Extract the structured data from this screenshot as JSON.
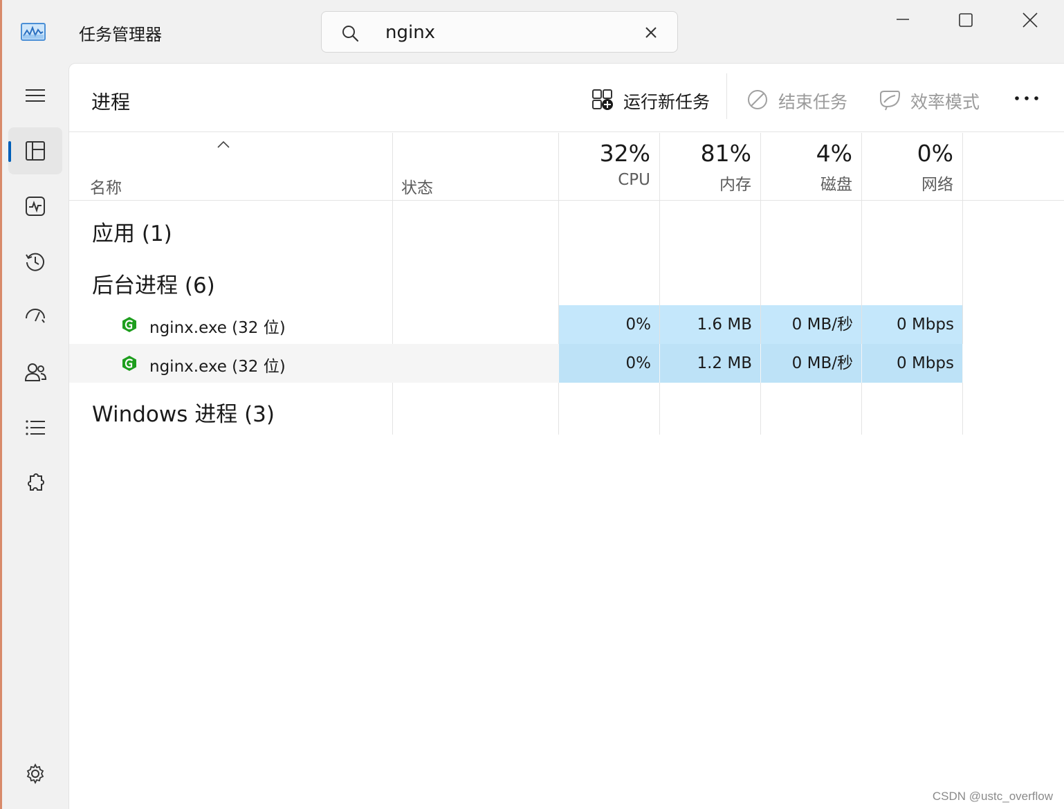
{
  "app": {
    "title": "任务管理器",
    "icon": "task-manager-app-icon"
  },
  "search": {
    "value": "nginx",
    "placeholder": "",
    "icon": "search-icon",
    "clear_icon": "close-icon"
  },
  "window_controls": [
    "minimize-icon",
    "maximize-icon",
    "close-icon"
  ],
  "nav": {
    "active": "processes",
    "items": [
      {
        "id": "menu",
        "icon": "hamburger-menu-icon"
      },
      {
        "id": "processes",
        "icon": "processes-icon"
      },
      {
        "id": "performance",
        "icon": "performance-icon"
      },
      {
        "id": "app-history",
        "icon": "history-icon"
      },
      {
        "id": "startup",
        "icon": "startup-gauge-icon"
      },
      {
        "id": "users",
        "icon": "users-icon"
      },
      {
        "id": "details",
        "icon": "details-list-icon"
      },
      {
        "id": "services",
        "icon": "services-puzzle-icon"
      },
      {
        "id": "settings",
        "icon": "settings-gear-icon"
      }
    ]
  },
  "page": {
    "title": "进程"
  },
  "toolbar": {
    "run_new_task": "运行新任务",
    "end_task": "结束任务",
    "efficiency_mode": "效率模式",
    "more_icon": "more-ellipsis-icon"
  },
  "columns": {
    "name": "名称",
    "status": "状态",
    "cpu": {
      "percent": "32%",
      "label": "CPU"
    },
    "memory": {
      "percent": "81%",
      "label": "内存"
    },
    "disk": {
      "percent": "4%",
      "label": "磁盘"
    },
    "network": {
      "percent": "0%",
      "label": "网络"
    }
  },
  "groups": {
    "apps": "应用 (1)",
    "background": "后台进程 (6)",
    "windows": "Windows 进程 (3)"
  },
  "processes": [
    {
      "name": "nginx.exe (32 位)",
      "cpu": "0%",
      "memory": "1.6 MB",
      "disk": "0 MB/秒",
      "network": "0 Mbps",
      "icon": "nginx-icon"
    },
    {
      "name": "nginx.exe (32 位)",
      "cpu": "0%",
      "memory": "1.2 MB",
      "disk": "0 MB/秒",
      "network": "0 Mbps",
      "icon": "nginx-icon"
    }
  ],
  "colors": {
    "accent": "#005fb8",
    "heat_cell": "#c4e7fb",
    "nginx_green": "#1e9e1e"
  },
  "watermark": "CSDN @ustc_overflow"
}
